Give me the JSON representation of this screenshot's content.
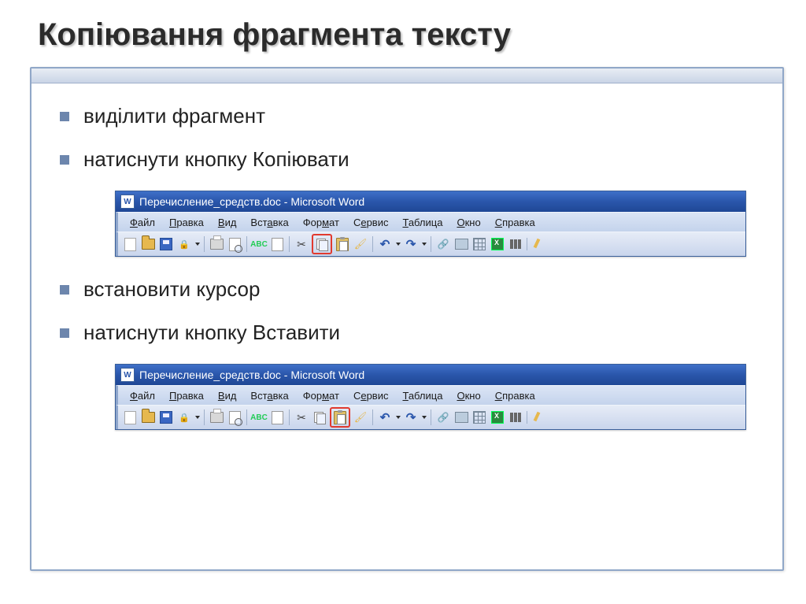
{
  "title": "Копіювання фрагмента тексту",
  "steps": [
    "виділити фрагмент",
    "натиснути кнопку Копіювати",
    "встановити курсор",
    "натиснути кнопку Вставити"
  ],
  "word": {
    "title": "Перечисление_средств.doc - Microsoft Word",
    "menu": [
      "Файл",
      "Правка",
      "Вид",
      "Вставка",
      "Формат",
      "Сервис",
      "Таблица",
      "Окно",
      "Справка"
    ]
  }
}
